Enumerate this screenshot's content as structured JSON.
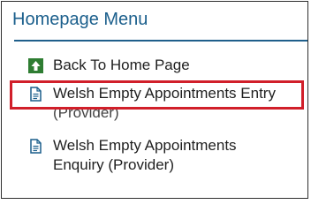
{
  "menu": {
    "title": "Homepage Menu",
    "items": [
      {
        "line1": "Back To Home Page",
        "line2": "",
        "icon": "back-arrow-icon",
        "icon_color": "#2e7d32"
      },
      {
        "line1": "Welsh Empty Appointments Entry",
        "line2": "(Provider)",
        "icon": "document-icon",
        "icon_color": "#1b5f8c",
        "highlighted": true
      },
      {
        "line1": "Welsh Empty Appointments",
        "line2": "Enquiry (Provider)",
        "icon": "document-icon",
        "icon_color": "#1b5f8c"
      }
    ]
  },
  "colors": {
    "title": "#1b5f8c",
    "highlight_border": "#d11f2a"
  }
}
